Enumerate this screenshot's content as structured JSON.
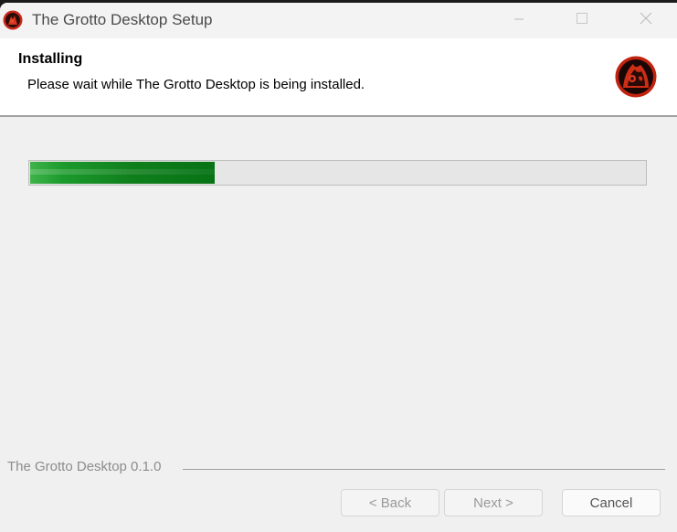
{
  "window": {
    "title": "The Grotto Desktop Setup",
    "app_icon": "grotto-logo-icon"
  },
  "window_controls": {
    "minimize": "minimize-icon",
    "maximize": "maximize-icon",
    "close": "close-icon"
  },
  "header": {
    "title": "Installing",
    "subtitle": "Please wait while The Grotto Desktop is being installed.",
    "logo": "grotto-logo-icon"
  },
  "progress": {
    "value": 0.3,
    "color": "#0f7f1c"
  },
  "footer": {
    "branding": "The Grotto Desktop 0.1.0"
  },
  "buttons": {
    "back": "< Back",
    "next": "Next >",
    "cancel": "Cancel"
  }
}
